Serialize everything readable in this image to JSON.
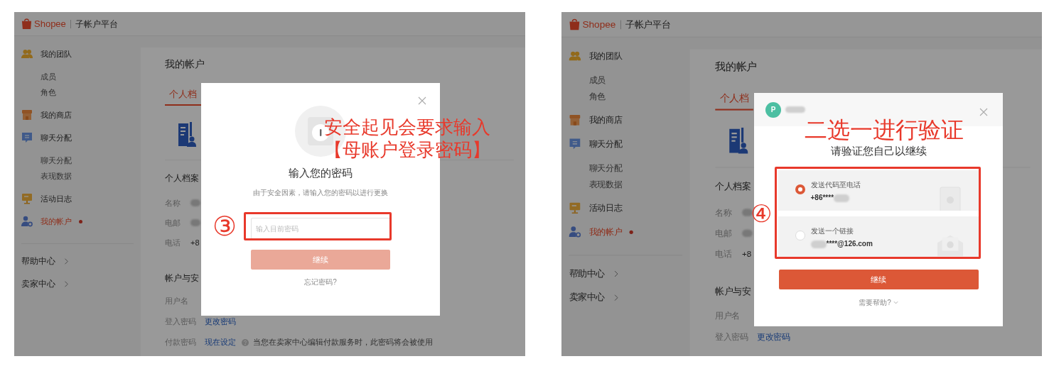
{
  "panels": [
    {
      "kind": "password",
      "header": {
        "brand": "Shopee",
        "product": "子帐户平台"
      },
      "sidebar": {
        "groups": [
          {
            "label": "我的团队",
            "selected": false,
            "dot": false,
            "children": [
              {
                "label": "成员"
              },
              {
                "label": "角色"
              }
            ]
          },
          {
            "label": "我的商店",
            "selected": false,
            "dot": false
          },
          {
            "label": "聊天分配",
            "selected": false,
            "dot": false,
            "children": [
              {
                "label": "聊天分配"
              },
              {
                "label": "表现数据"
              }
            ]
          },
          {
            "label": "活动日志",
            "selected": false,
            "dot": false
          },
          {
            "label": "我的帐户",
            "selected": true,
            "dot": true
          }
        ],
        "links": [
          {
            "label": "帮助中心"
          },
          {
            "label": "卖家中心"
          }
        ]
      },
      "page": {
        "title": "我的帐户",
        "tabs": [
          {
            "label": "个人档",
            "selected": true
          }
        ],
        "sections": [
          {
            "title": "个人档案",
            "rows": [
              {
                "label": "名称",
                "blurred": true
              },
              {
                "label": "电邮",
                "blurred": true
              },
              {
                "label": "电话",
                "value": "+8"
              }
            ]
          },
          {
            "title": "帐户与安",
            "rows": [
              {
                "label": "用户名"
              },
              {
                "label": "登入密码",
                "link": "更改密码"
              },
              {
                "label": "付款密码",
                "link": "现在设定",
                "help": true,
                "note": "当您在卖家中心编辑付款服务时，此密码将会被使用"
              }
            ]
          }
        ]
      },
      "dialog": {
        "title": "输入您的密码",
        "subtitle": "由于安全因素，请输入您的密码以进行更换",
        "field": {
          "placeholder": "输入目前密码"
        },
        "button": {
          "label": "继续",
          "disabled": true
        },
        "link": "忘记密码?"
      },
      "annotation": {
        "number": "③",
        "lines": [
          "安全起见会要求输入",
          "【母账户登录密码】"
        ]
      }
    },
    {
      "kind": "verify",
      "header": {
        "brand": "Shopee",
        "product": "子帐户平台"
      },
      "sidebar": {
        "groups": [
          {
            "label": "我的团队",
            "selected": false,
            "dot": false,
            "children": [
              {
                "label": "成员"
              },
              {
                "label": "角色"
              }
            ]
          },
          {
            "label": "我的商店",
            "selected": false,
            "dot": false
          },
          {
            "label": "聊天分配",
            "selected": false,
            "dot": false,
            "children": [
              {
                "label": "聊天分配"
              },
              {
                "label": "表现数据"
              }
            ]
          },
          {
            "label": "活动日志",
            "selected": false,
            "dot": false
          },
          {
            "label": "我的帐户",
            "selected": true,
            "dot": true
          }
        ],
        "links": [
          {
            "label": "帮助中心"
          },
          {
            "label": "卖家中心"
          }
        ]
      },
      "page": {
        "title": "我的帐户",
        "tabs": [
          {
            "label": "个人档",
            "selected": true
          }
        ],
        "sections": [
          {
            "title": "个人档案",
            "rows": [
              {
                "label": "名称",
                "blurred": true
              },
              {
                "label": "电邮",
                "blurred": true
              },
              {
                "label": "电话",
                "value": "+8"
              }
            ]
          },
          {
            "title": "帐户与安",
            "rows": [
              {
                "label": "用户名"
              },
              {
                "label": "登入密码",
                "link": "更改密码"
              }
            ]
          }
        ]
      },
      "dialog": {
        "avatar": "P",
        "title": "请验证您自己以继续",
        "options": [
          {
            "title": "发送代码至电话",
            "detail": "+86****",
            "blurred_before": false,
            "blurred_after": true,
            "selected": true
          },
          {
            "title": "发送一个链接",
            "detail": "****@126.com",
            "blurred_before": true,
            "blurred_after": false,
            "selected": false
          }
        ],
        "button": {
          "label": "继续",
          "disabled": false
        },
        "link": "需要帮助?"
      },
      "annotation": {
        "number": "④",
        "lines": [
          "二选一进行验证"
        ]
      }
    }
  ]
}
